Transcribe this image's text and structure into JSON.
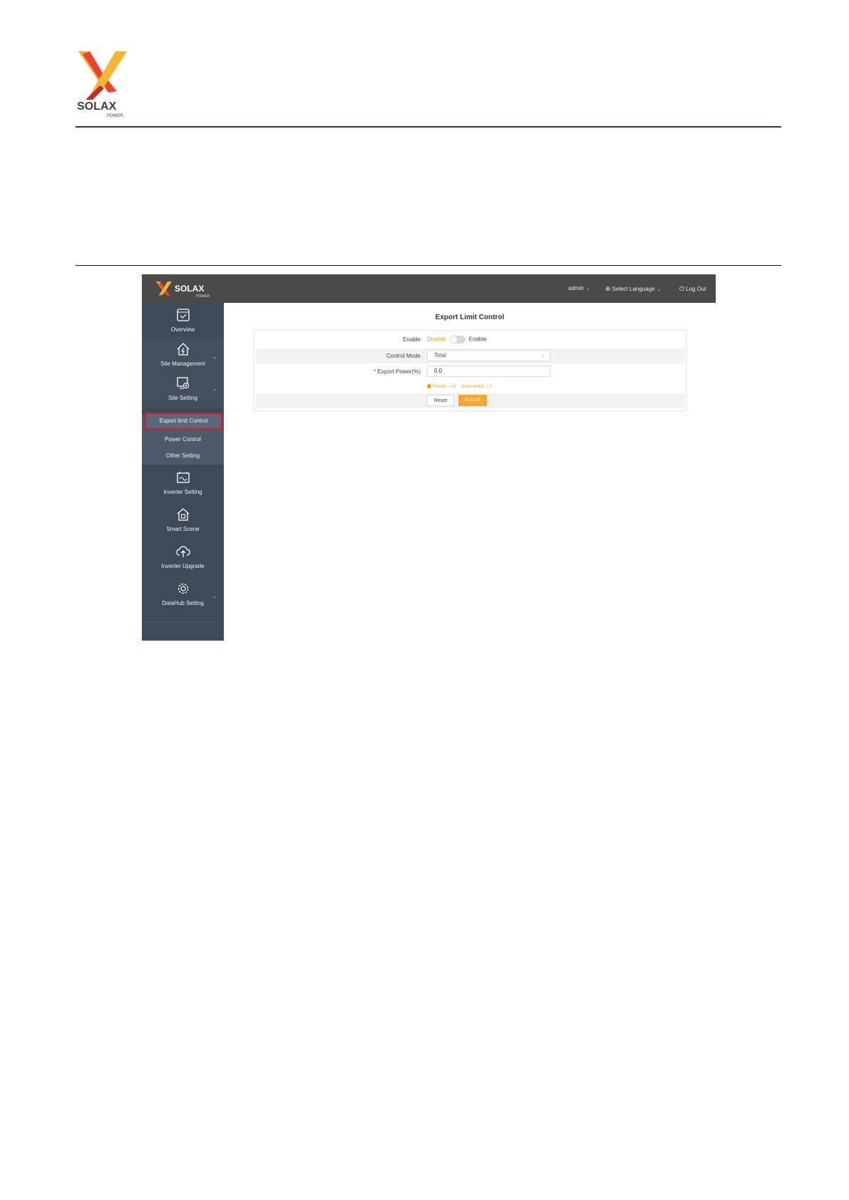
{
  "document": {
    "logo_icon": "solax-x-logo",
    "logo_text": "SOLAX",
    "logo_subtext": "POWER"
  },
  "header": {
    "logo_text": "SOLAX",
    "logo_subtext": "POWER",
    "user": "admin",
    "language": "Select Language",
    "logout": "Log Out"
  },
  "sidebar": {
    "items": [
      {
        "label": "Overview",
        "icon": "overview-icon"
      },
      {
        "label": "Site Management",
        "icon": "home-bolt-icon"
      },
      {
        "label": "Site Setting",
        "icon": "monitor-gear-icon"
      },
      {
        "label": "Inverter Setting",
        "icon": "inverter-icon"
      },
      {
        "label": "Smart Scene",
        "icon": "smart-home-icon"
      },
      {
        "label": "Inverter Upgrade",
        "icon": "cloud-upload-icon"
      },
      {
        "label": "DataHub Setting",
        "icon": "gear-icon"
      }
    ],
    "subitems": [
      {
        "label": "Export limit Control",
        "active": true
      },
      {
        "label": "Power Control"
      },
      {
        "label": "Other Setting"
      }
    ]
  },
  "main": {
    "title": "Export Limit Control",
    "enable_label": "Enable",
    "enable_off": "Disable",
    "enable_on": "Enable",
    "enabled": false,
    "control_mode_label": "Control Mode",
    "control_mode_value": "Total",
    "export_power_label": "* Export Power(%)",
    "export_power_value": "0.0",
    "hint_feedin": "Feedin（+）",
    "hint_consumed": "Consumed（-）",
    "reset_label": "Reset",
    "submit_label": "Submit"
  },
  "colors": {
    "accent": "#f7a531",
    "sidebar": "#3f4a58",
    "topbar": "#4a4a4a",
    "highlight": "#d21f27"
  }
}
